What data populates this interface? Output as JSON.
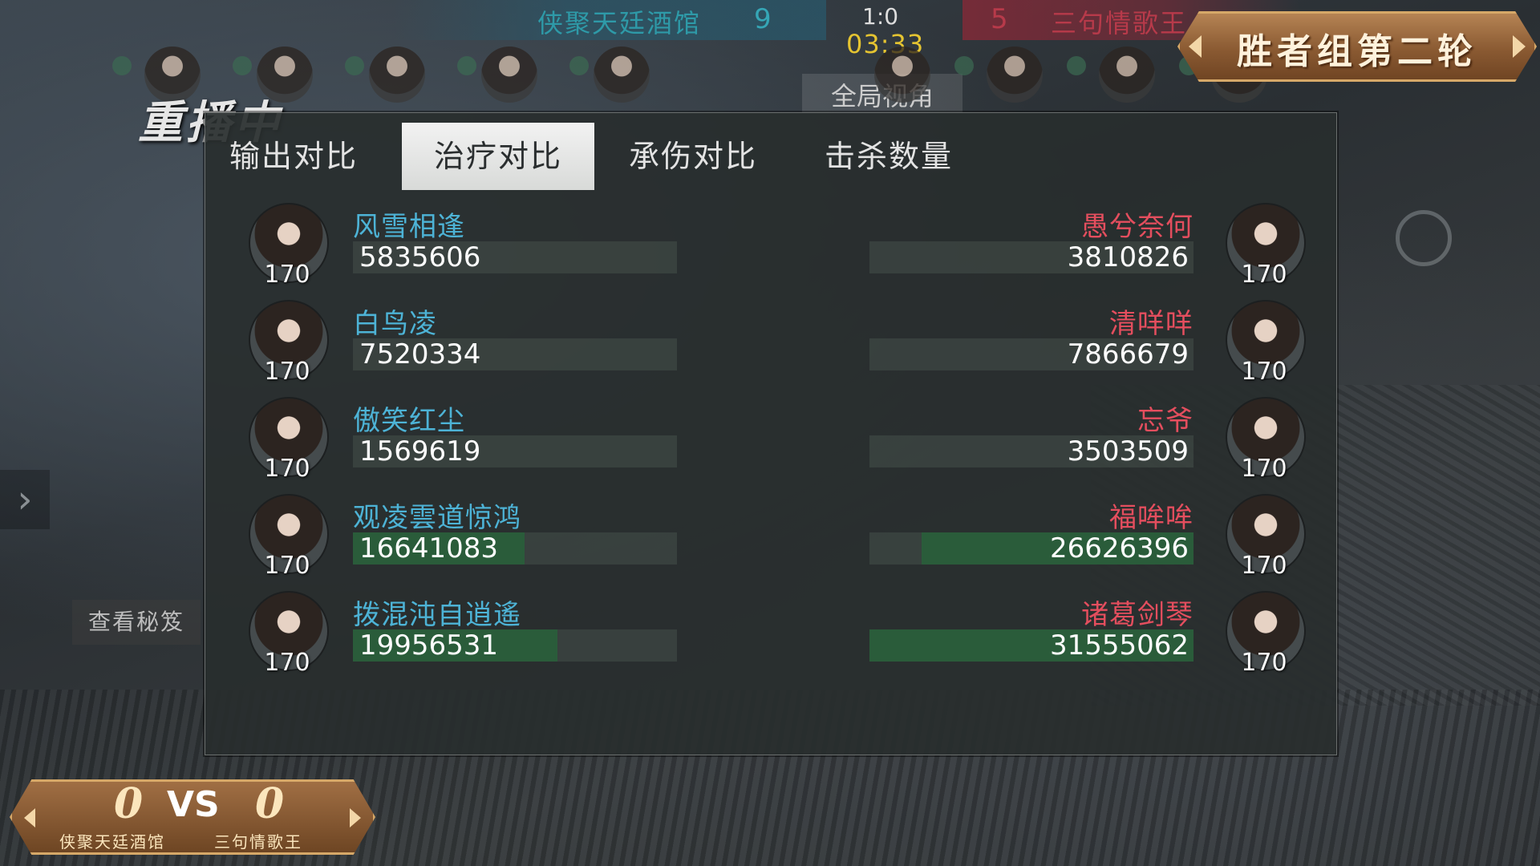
{
  "top": {
    "left_team": "侠聚天廷酒馆",
    "left_score": "9",
    "right_team": "三句情歌王",
    "right_score": "5",
    "round_score": "1:0",
    "timer": "03:33",
    "view_button": "全局视角"
  },
  "replay_label": "重播中",
  "banner": "胜者组第二轮",
  "tabs": [
    "输出对比",
    "治疗对比",
    "承伤对比",
    "击杀数量"
  ],
  "active_tab": "治疗对比",
  "left_players": [
    {
      "name": "风雪相逢",
      "value": "5835606",
      "level": "170",
      "fill": 0.0
    },
    {
      "name": "白鸟凌",
      "value": "7520334",
      "level": "170",
      "fill": 0.0
    },
    {
      "name": "傲笑红尘",
      "value": "1569619",
      "level": "170",
      "fill": 0.0
    },
    {
      "name": "观凌雲道惊鸿",
      "value": "16641083",
      "level": "170",
      "fill": 0.53
    },
    {
      "name": "拨混沌自逍遙",
      "value": "19956531",
      "level": "170",
      "fill": 0.63
    }
  ],
  "right_players": [
    {
      "name": "愚兮奈何",
      "value": "3810826",
      "level": "170",
      "fill": 0.0
    },
    {
      "name": "清咩咩",
      "value": "7866679",
      "level": "170",
      "fill": 0.0
    },
    {
      "name": "忘爷",
      "value": "3503509",
      "level": "170",
      "fill": 0.0
    },
    {
      "name": "福哞哞",
      "value": "26626396",
      "level": "170",
      "fill": 0.84
    },
    {
      "name": "诸葛剑琴",
      "value": "31555062",
      "level": "170",
      "fill": 1.0
    }
  ],
  "scoreboard": {
    "left_score": "0",
    "vs": "VS",
    "right_score": "0",
    "left_team": "侠聚天廷酒馆",
    "right_team": "三句情歌王"
  },
  "secret_button": "查看秘笈"
}
